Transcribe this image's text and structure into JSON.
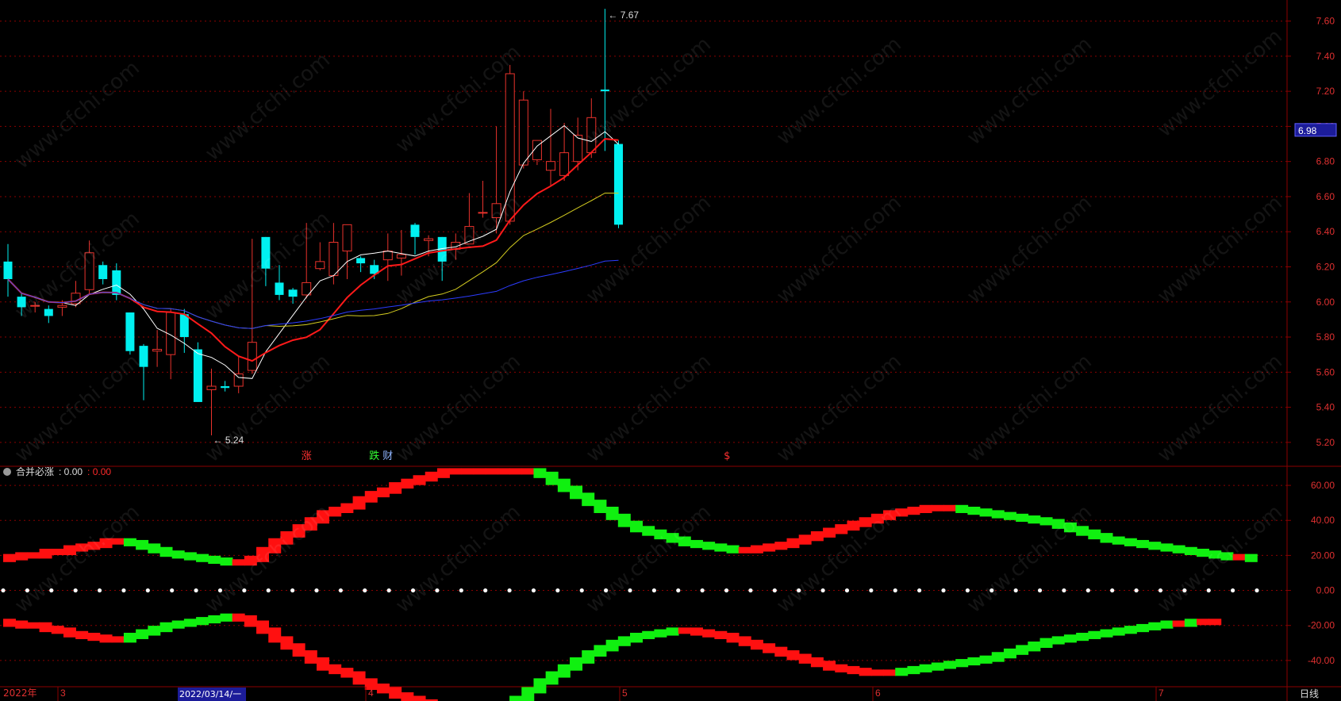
{
  "watermark": "www.cfchi.com",
  "colors": {
    "bg": "#000000",
    "up": "#e8322c",
    "down": "#00f0f0",
    "ma5": "#ffffff",
    "ma10": "#ff1a1a",
    "ma20": "#d4cc20",
    "ma60": "#2c3cff",
    "grid": "#8b0000",
    "pos_red": "#ff1010",
    "pos_green": "#10f010",
    "axis_text": "#e03030"
  },
  "chart_data": [
    {
      "type": "candlestick",
      "title": "",
      "ylim": [
        5.1,
        7.72
      ],
      "yticks": [
        "5.20",
        "5.40",
        "5.60",
        "5.80",
        "6.00",
        "6.20",
        "6.40",
        "6.60",
        "6.80",
        "7.00",
        "7.20",
        "7.40",
        "7.60"
      ],
      "current_price": "6.98",
      "high_label": "7.67",
      "low_label": "5.24",
      "markers": [
        {
          "text": "涨",
          "index": 22,
          "color": "#ff3030"
        },
        {
          "text": "跌",
          "index": 27,
          "color": "#33ff33"
        },
        {
          "text": "财",
          "index": 28,
          "color": "#8fb4ff"
        },
        {
          "text": "$",
          "index": 53,
          "color": "#ff3030"
        }
      ],
      "candles": [
        [
          6.23,
          6.13,
          6.33,
          6.03
        ],
        [
          6.03,
          5.97,
          6.05,
          5.92
        ],
        [
          5.98,
          5.98,
          6.0,
          5.94
        ],
        [
          5.96,
          5.92,
          5.98,
          5.88
        ],
        [
          5.97,
          5.98,
          6.01,
          5.92
        ],
        [
          5.99,
          6.05,
          6.12,
          5.97
        ],
        [
          6.07,
          6.28,
          6.35,
          6.04
        ],
        [
          6.21,
          6.13,
          6.23,
          6.1
        ],
        [
          6.18,
          6.04,
          6.22,
          6.01
        ],
        [
          5.94,
          5.72,
          5.94,
          5.7
        ],
        [
          5.75,
          5.63,
          5.76,
          5.44
        ],
        [
          5.72,
          5.73,
          5.84,
          5.63
        ],
        [
          5.7,
          5.94,
          5.96,
          5.56
        ],
        [
          5.93,
          5.8,
          5.96,
          5.71
        ],
        [
          5.73,
          5.43,
          5.77,
          5.43
        ],
        [
          5.5,
          5.52,
          5.62,
          5.24
        ],
        [
          5.52,
          5.51,
          5.55,
          5.49
        ],
        [
          5.52,
          5.59,
          5.69,
          5.48
        ],
        [
          5.61,
          5.77,
          6.36,
          5.59
        ],
        [
          6.37,
          6.19,
          6.37,
          6.09
        ],
        [
          6.11,
          6.04,
          6.21,
          6.01
        ],
        [
          6.07,
          6.03,
          6.08,
          5.99
        ],
        [
          6.04,
          6.11,
          6.45,
          6.02
        ],
        [
          6.19,
          6.23,
          6.34,
          6.18
        ],
        [
          6.15,
          6.34,
          6.45,
          6.1
        ],
        [
          6.29,
          6.44,
          6.44,
          6.13
        ],
        [
          6.25,
          6.22,
          6.26,
          6.17
        ],
        [
          6.21,
          6.16,
          6.24,
          6.13
        ],
        [
          6.24,
          6.29,
          6.39,
          6.12
        ],
        [
          6.25,
          6.27,
          6.41,
          6.15
        ],
        [
          6.44,
          6.37,
          6.45,
          6.27
        ],
        [
          6.35,
          6.36,
          6.38,
          6.26
        ],
        [
          6.37,
          6.23,
          6.37,
          6.12
        ],
        [
          6.3,
          6.34,
          6.39,
          6.24
        ],
        [
          6.33,
          6.43,
          6.62,
          6.33
        ],
        [
          6.51,
          6.51,
          6.69,
          6.48
        ],
        [
          6.48,
          6.56,
          7.0,
          6.39
        ],
        [
          6.46,
          7.3,
          7.35,
          6.44
        ],
        [
          6.78,
          7.15,
          7.2,
          6.76
        ],
        [
          6.81,
          6.92,
          6.87,
          6.78
        ],
        [
          6.75,
          6.8,
          7.1,
          6.66
        ],
        [
          6.72,
          6.85,
          7.02,
          6.69
        ],
        [
          6.8,
          6.95,
          7.05,
          6.75
        ],
        [
          6.85,
          7.05,
          7.16,
          6.82
        ],
        [
          7.21,
          7.2,
          7.67,
          6.86
        ],
        [
          6.9,
          6.44,
          6.92,
          6.42
        ]
      ]
    },
    {
      "type": "area",
      "title": "合并必涨",
      "value_label": ": 0.00",
      "value_label_2": ": 0.00",
      "ylim": [
        -55,
        70
      ],
      "yticks": [
        "60.00",
        "40.00",
        "20.00",
        "0.00",
        "-20.00",
        "-40.00"
      ],
      "upper": [
        18,
        19,
        20,
        20,
        22,
        22,
        24,
        25,
        26,
        28,
        28,
        27,
        25,
        23,
        21,
        20,
        19,
        18,
        17,
        16,
        16,
        18,
        23,
        28,
        32,
        36,
        40,
        44,
        46,
        48,
        52,
        55,
        57,
        60,
        62,
        64,
        66,
        68,
        68,
        68,
        68,
        68,
        68,
        68,
        68,
        66,
        62,
        58,
        54,
        50,
        46,
        42,
        38,
        35,
        33,
        31,
        29,
        27,
        26,
        25,
        24,
        23,
        23,
        24,
        25,
        26,
        28,
        30,
        32,
        34,
        36,
        38,
        40,
        42,
        44,
        45,
        46,
        47,
        47,
        47,
        46,
        45,
        44,
        43,
        42,
        41,
        40,
        39,
        37,
        35,
        33,
        31,
        29,
        28,
        27,
        26,
        25,
        24,
        23,
        22,
        21,
        20,
        19,
        19,
        18
      ],
      "lower": [
        -18,
        -19,
        -20,
        -20,
        -22,
        -23,
        -25,
        -26,
        -27,
        -28,
        -28,
        -26,
        -24,
        -22,
        -20,
        -19,
        -18,
        -17,
        -16,
        -15,
        -16,
        -19,
        -23,
        -28,
        -32,
        -36,
        -40,
        -44,
        -46,
        -48,
        -52,
        -55,
        -57,
        -60,
        -62,
        -64,
        -66,
        -68,
        -68,
        -68,
        -68,
        -68,
        -66,
        -62,
        -57,
        -52,
        -48,
        -44,
        -40,
        -36,
        -33,
        -30,
        -28,
        -26,
        -25,
        -24,
        -23,
        -23,
        -24,
        -25,
        -26,
        -28,
        -30,
        -32,
        -34,
        -36,
        -38,
        -40,
        -42,
        -44,
        -45,
        -46,
        -47,
        -47,
        -47,
        -46,
        -45,
        -44,
        -43,
        -42,
        -41,
        -40,
        -39,
        -37,
        -35,
        -33,
        -31,
        -29,
        -28,
        -27,
        -26,
        -25,
        -24,
        -23,
        -22,
        -21,
        -20,
        -19,
        -19,
        -18,
        -18,
        -18
      ]
    }
  ],
  "x_axis": {
    "year_label": "2022年",
    "month_labels": [
      "3",
      "4",
      "5",
      "6",
      "7"
    ],
    "cursor_date": "2022/03/14/一",
    "period_label": "日线"
  }
}
